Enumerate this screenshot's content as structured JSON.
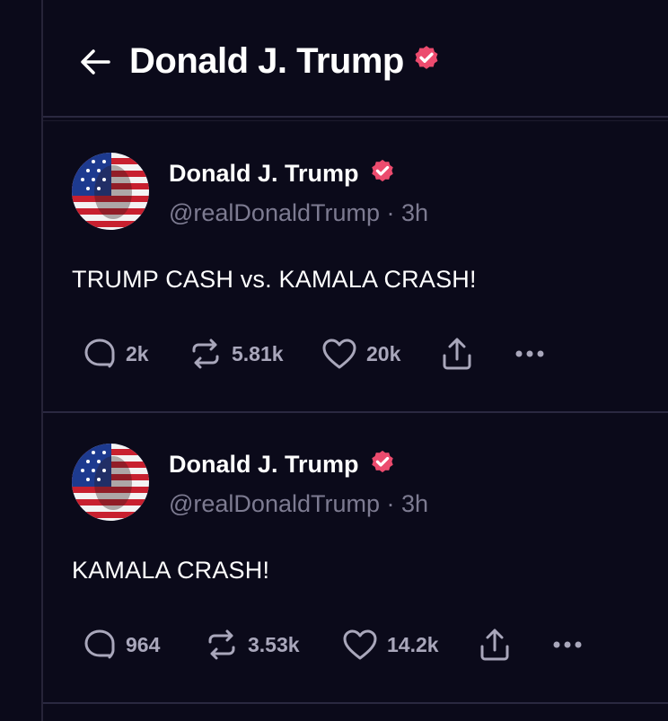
{
  "header": {
    "title": "Donald J. Trump"
  },
  "posts": [
    {
      "author": "Donald J. Trump",
      "handle": "@realDonaldTrump",
      "time": "3h",
      "text": "TRUMP CASH vs. KAMALA CRASH!",
      "replies": "2k",
      "reposts": "5.81k",
      "likes": "20k"
    },
    {
      "author": "Donald J. Trump",
      "handle": "@realDonaldTrump",
      "time": "3h",
      "text": "KAMALA CRASH!",
      "replies": "964",
      "reposts": "3.53k",
      "likes": "14.2k"
    }
  ],
  "colors": {
    "background": "#0b0a1a",
    "badge": "#ec4b6e",
    "muted": "#7d7b91",
    "divider": "#2a2840"
  },
  "icons": [
    "back-arrow-icon",
    "verified-badge-icon",
    "reply-icon",
    "repost-icon",
    "like-icon",
    "share-icon",
    "more-icon"
  ]
}
